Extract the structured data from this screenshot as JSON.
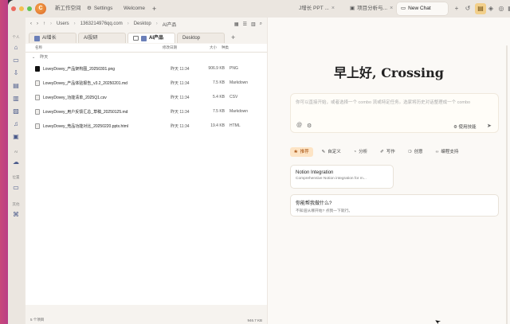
{
  "tabs": {
    "workspace": "新工作空间",
    "settings": "Settings",
    "welcome": "Welcome",
    "add": "+",
    "tab_a": "J增长 PPT ...",
    "tab_b": "项目分析与...",
    "active": "New Chat"
  },
  "rail": {
    "personal_label": "个人",
    "ai_label": "AI",
    "storage_label": "位置",
    "tools_label": "其他"
  },
  "files": {
    "breadcrumb": [
      "Users",
      "1363214976qq.com",
      "Desktop",
      "AI产品"
    ],
    "tabs": [
      {
        "label": "AI增长"
      },
      {
        "label": "AI投研"
      },
      {
        "label": "AI产品"
      },
      {
        "label": "Desktop"
      }
    ],
    "columns": {
      "name": "名称",
      "date": "修改日期",
      "size": "大小",
      "kind": "种类"
    },
    "group": "昨天",
    "rows": [
      {
        "name": "LoveyDovey_产品架构图_20250301.png",
        "date": "昨天 11:34",
        "size": "906.9 KB",
        "kind": "PNG"
      },
      {
        "name": "LoveyDovey_产品体验报告_v3.2_20250201.md",
        "date": "昨天 11:34",
        "size": "7.5 KB",
        "kind": "Markdown"
      },
      {
        "name": "LoveyDovey_功能清单_2025Q1.csv",
        "date": "昨天 11:34",
        "size": "5.4 KB",
        "kind": "CSV"
      },
      {
        "name": "LoveyDovey_用户反馈汇总_草稿_20250125.md",
        "date": "昨天 11:34",
        "size": "7.5 KB",
        "kind": "Markdown"
      },
      {
        "name": "LoveyDovey_竞品功能对比_20250220.pptx.html",
        "date": "昨天 11:34",
        "size": "19.4 KB",
        "kind": "HTML"
      }
    ],
    "status_left": "5 个项目",
    "status_right": "946.7 KB"
  },
  "chat": {
    "greeting": "早上好, Crossing",
    "placeholder": "你可以直接开始，或者选择一个 combo 流或特定任务。选家将历史对话整理成一个 combo",
    "use_skill": "使用技能",
    "chips": [
      {
        "icon": "❀",
        "label": "推荐"
      },
      {
        "icon": "✎",
        "label": "自定义"
      },
      {
        "icon": "◔",
        "label": "分析"
      },
      {
        "icon": "✐",
        "label": "写作"
      },
      {
        "icon": "❍",
        "label": "创意"
      },
      {
        "icon": "‹›",
        "label": "编程支持"
      }
    ],
    "card1_title": "Notion Integration",
    "card1_desc": "Comprehensive Notion integration for m...",
    "card2_title": "你能帮我做什么?",
    "card2_desc": "不知道从哪开始? 点我一下就行。"
  }
}
